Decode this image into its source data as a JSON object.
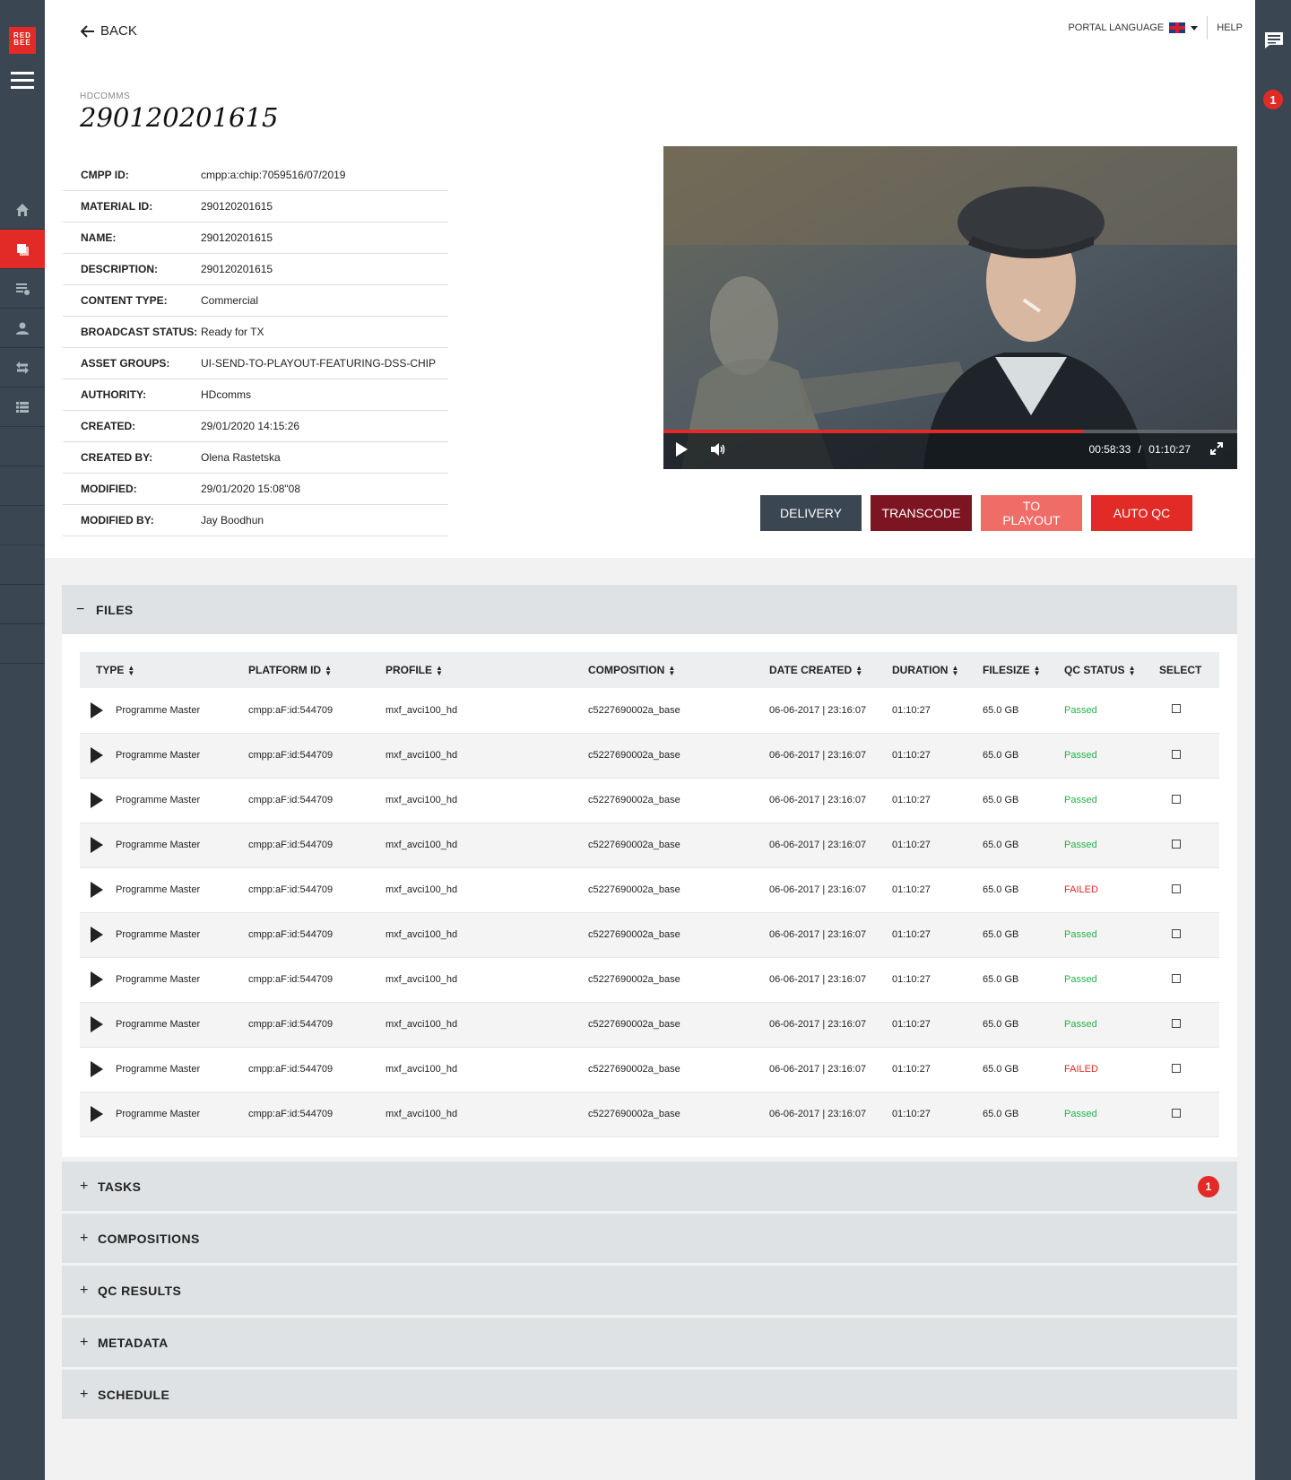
{
  "sidebar": {
    "logo_text": "RED BEE",
    "items": [
      {
        "icon": "home-icon"
      },
      {
        "icon": "assets-icon"
      },
      {
        "icon": "queue-icon"
      },
      {
        "icon": "user-icon"
      },
      {
        "icon": "transfer-icon"
      },
      {
        "icon": "list-icon"
      }
    ]
  },
  "header": {
    "back_label": "BACK",
    "portal_language_label": "PORTAL LANGUAGE",
    "help_label": "HELP",
    "notification_count": "1"
  },
  "asset": {
    "owner": "HDCOMMS",
    "title": "290120201615",
    "fields": [
      {
        "label": "CMPP ID:",
        "value": "cmpp:a:chip:7059516/07/2019"
      },
      {
        "label": "MATERIAL ID:",
        "value": "290120201615"
      },
      {
        "label": "NAME:",
        "value": "290120201615"
      },
      {
        "label": "DESCRIPTION:",
        "value": "290120201615"
      },
      {
        "label": "CONTENT TYPE:",
        "value": "Commercial"
      },
      {
        "label": "BROADCAST STATUS:",
        "value": "Ready for TX"
      },
      {
        "label": "ASSET GROUPS:",
        "value": "UI-SEND-TO-PLAYOUT-FEATURING-DSS-CHIP"
      },
      {
        "label": "AUTHORITY:",
        "value": "HDcomms"
      },
      {
        "label": "CREATED:",
        "value": "29/01/2020  14:15:26"
      },
      {
        "label": "CREATED BY:",
        "value": "Olena Rastetska"
      },
      {
        "label": "MODIFIED:",
        "value": "29/01/2020  15:08\"08"
      },
      {
        "label": "MODIFIED BY:",
        "value": "Jay Boodhun"
      }
    ]
  },
  "player": {
    "current_time": "00:58:33",
    "separator": "/",
    "total_time": "01:10:27",
    "progress_fraction": 0.731
  },
  "actions": {
    "delivery": "DELIVERY",
    "transcode": "TRANSCODE",
    "to_playout": "TO PLAYOUT",
    "auto_qc": "AUTO QC"
  },
  "files": {
    "section_label": "FILES",
    "columns": [
      "TYPE",
      "PLATFORM ID",
      "PROFILE",
      "COMPOSITION",
      "DATE CREATED",
      "DURATION",
      "FILESIZE",
      "QC STATUS",
      "SELECT"
    ],
    "rows": [
      {
        "type": "Programme Master",
        "platform_id": "cmpp:aF:id:544709",
        "profile": "mxf_avci100_hd",
        "composition": "c5227690002a_base",
        "date_created": "06-06-2017 | 23:16:07",
        "duration": "01:10:27",
        "filesize": "65.0 GB",
        "qc_status": "Passed"
      },
      {
        "type": "Programme Master",
        "platform_id": "cmpp:aF:id:544709",
        "profile": "mxf_avci100_hd",
        "composition": "c5227690002a_base",
        "date_created": "06-06-2017 | 23:16:07",
        "duration": "01:10:27",
        "filesize": "65.0 GB",
        "qc_status": "Passed"
      },
      {
        "type": "Programme Master",
        "platform_id": "cmpp:aF:id:544709",
        "profile": "mxf_avci100_hd",
        "composition": "c5227690002a_base",
        "date_created": "06-06-2017 | 23:16:07",
        "duration": "01:10:27",
        "filesize": "65.0 GB",
        "qc_status": "Passed"
      },
      {
        "type": "Programme Master",
        "platform_id": "cmpp:aF:id:544709",
        "profile": "mxf_avci100_hd",
        "composition": "c5227690002a_base",
        "date_created": "06-06-2017 | 23:16:07",
        "duration": "01:10:27",
        "filesize": "65.0 GB",
        "qc_status": "Passed"
      },
      {
        "type": "Programme Master",
        "platform_id": "cmpp:aF:id:544709",
        "profile": "mxf_avci100_hd",
        "composition": "c5227690002a_base",
        "date_created": "06-06-2017 | 23:16:07",
        "duration": "01:10:27",
        "filesize": "65.0 GB",
        "qc_status": "FAILED"
      },
      {
        "type": "Programme Master",
        "platform_id": "cmpp:aF:id:544709",
        "profile": "mxf_avci100_hd",
        "composition": "c5227690002a_base",
        "date_created": "06-06-2017 | 23:16:07",
        "duration": "01:10:27",
        "filesize": "65.0 GB",
        "qc_status": "Passed"
      },
      {
        "type": "Programme Master",
        "platform_id": "cmpp:aF:id:544709",
        "profile": "mxf_avci100_hd",
        "composition": "c5227690002a_base",
        "date_created": "06-06-2017 | 23:16:07",
        "duration": "01:10:27",
        "filesize": "65.0 GB",
        "qc_status": "Passed"
      },
      {
        "type": "Programme Master",
        "platform_id": "cmpp:aF:id:544709",
        "profile": "mxf_avci100_hd",
        "composition": "c5227690002a_base",
        "date_created": "06-06-2017 | 23:16:07",
        "duration": "01:10:27",
        "filesize": "65.0 GB",
        "qc_status": "Passed"
      },
      {
        "type": "Programme Master",
        "platform_id": "cmpp:aF:id:544709",
        "profile": "mxf_avci100_hd",
        "composition": "c5227690002a_base",
        "date_created": "06-06-2017 | 23:16:07",
        "duration": "01:10:27",
        "filesize": "65.0 GB",
        "qc_status": "FAILED"
      },
      {
        "type": "Programme Master",
        "platform_id": "cmpp:aF:id:544709",
        "profile": "mxf_avci100_hd",
        "composition": "c5227690002a_base",
        "date_created": "06-06-2017 | 23:16:07",
        "duration": "01:10:27",
        "filesize": "65.0 GB",
        "qc_status": "Passed"
      }
    ]
  },
  "sections": [
    {
      "label": "TASKS",
      "badge": "1"
    },
    {
      "label": "COMPOSITIONS"
    },
    {
      "label": "QC RESULTS"
    },
    {
      "label": "METADATA"
    },
    {
      "label": "SCHEDULE"
    }
  ],
  "colors": {
    "brand_red": "#e22a26",
    "sidebar": "#3a4651",
    "transcode": "#7d1421",
    "to_playout": "#ef6d66",
    "passed": "#27b24a"
  }
}
